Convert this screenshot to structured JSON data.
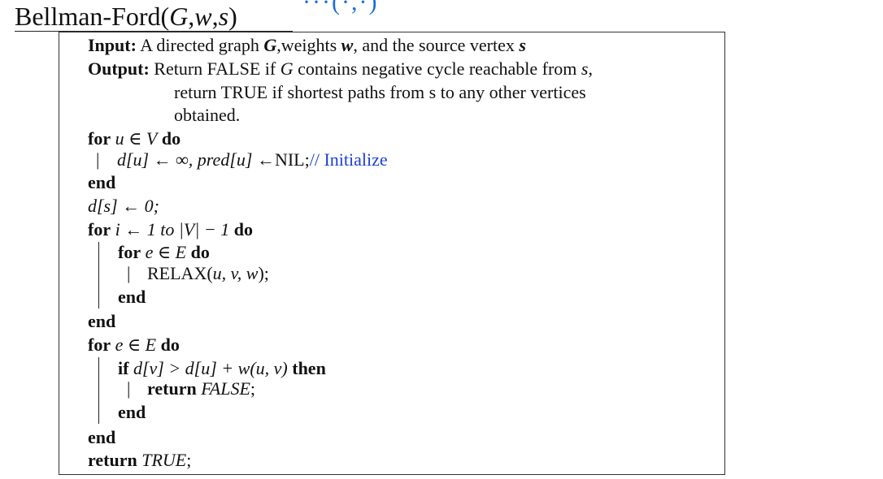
{
  "cut_glyphs": "···(·,·)",
  "title": {
    "name": "Bellman-Ford(",
    "g": "G",
    "comma1": ",",
    "w": "w",
    "comma2": ",",
    "s": "s",
    "close": ")"
  },
  "input": {
    "label": "Input:",
    "text1": "A directed graph ",
    "g": "G",
    "text2": ",weights ",
    "w": "w",
    "text3": ", and the source vertex ",
    "s": "s"
  },
  "output": {
    "label": "Output:",
    "line1a": "Return FALSE if ",
    "line1g": "G",
    "line1b": " contains negative cycle reachable from ",
    "line1s": "s",
    "line1c": ",",
    "line2": "return TRUE if shortest paths from s to any other vertices",
    "line3": "obtained."
  },
  "code": {
    "for1_kw": "for",
    "for1_expr": "u ∈ V",
    "do_kw": "do",
    "init_stmt": "d[u] ← ∞, pred[u] ←",
    "init_nil": "NIL;",
    "init_comment": "// Initialize",
    "end_kw": "end",
    "ds_stmt": "d[s] ← 0;",
    "for2_expr_a": "i ← 1 ",
    "for2_to": "to",
    "for2_expr_b": " |V| − 1",
    "for3_expr": "e ∈ E",
    "relax_name": "RELAX(",
    "relax_args": "u, v, w",
    "relax_close": ");",
    "for4_expr": "e ∈ E",
    "if_kw": "if",
    "if_expr": "d[v] > d[u] + w(u, v)",
    "then_kw": "then",
    "return_kw": "return",
    "false_val": "FALSE",
    "true_val": "TRUE",
    "semicolon": ";"
  }
}
